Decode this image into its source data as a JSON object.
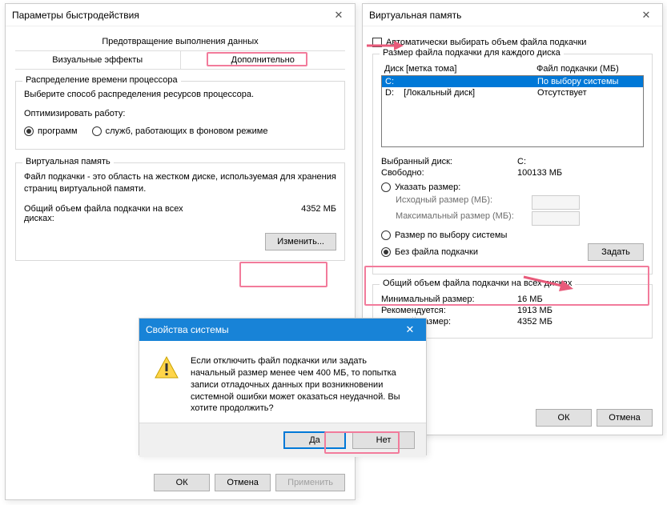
{
  "perf": {
    "title": "Параметры быстродействия",
    "tab_top": "Предотвращение выполнения данных",
    "tab_visual": "Визуальные эффекты",
    "tab_advanced": "Дополнительно",
    "cpu_legend": "Распределение времени процессора",
    "cpu_desc": "Выберите способ распределения ресурсов процессора.",
    "optimize_label": "Оптимизировать работу:",
    "radio_programs": "программ",
    "radio_services": "служб, работающих в фоновом режиме",
    "vm_legend": "Виртуальная память",
    "vm_desc": "Файл подкачки - это область на жестком диске, используемая для хранения страниц виртуальной памяти.",
    "vm_total_label": "Общий объем файла подкачки на всех дисках:",
    "vm_total_value": "4352 МБ",
    "change_btn": "Изменить...",
    "ok": "ОК",
    "cancel": "Отмена",
    "apply": "Применить"
  },
  "vmem": {
    "title": "Виртуальная память",
    "auto_checkbox": "Автоматически выбирать объем файла подкачки",
    "group_legend": "Размер файла подкачки для каждого диска",
    "col_disk": "Диск [метка тома]",
    "col_file": "Файл подкачки (МБ)",
    "rows": [
      {
        "disk": "C:",
        "label": "",
        "file": "По выбору системы"
      },
      {
        "disk": "D:",
        "label": "[Локальный диск]",
        "file": "Отсутствует"
      }
    ],
    "selected_disk_label": "Выбранный диск:",
    "selected_disk_value": "C:",
    "free_label": "Свободно:",
    "free_value": "100133 МБ",
    "radio_custom": "Указать размер:",
    "initial_label": "Исходный размер (МБ):",
    "max_label": "Максимальный размер (МБ):",
    "radio_system": "Размер по выбору системы",
    "radio_none": "Без файла подкачки",
    "set_btn": "Задать",
    "totals_legend": "Общий объем файла подкачки на всех дисках",
    "min_label": "Минимальный размер:",
    "min_value": "16 МБ",
    "rec_label": "Рекомендуется:",
    "rec_value": "1913 МБ",
    "cur_label": "Текущий размер:",
    "cur_value": "4352 МБ",
    "ok": "ОК",
    "cancel": "Отмена"
  },
  "msg": {
    "title": "Свойства системы",
    "text": "Если отключить файл подкачки или задать начальный размер менее чем 400 МБ, то попытка записи отладочных данных при возникновении системной ошибки может оказаться неудачной. Вы хотите продолжить?",
    "yes": "Да",
    "no": "Нет"
  }
}
